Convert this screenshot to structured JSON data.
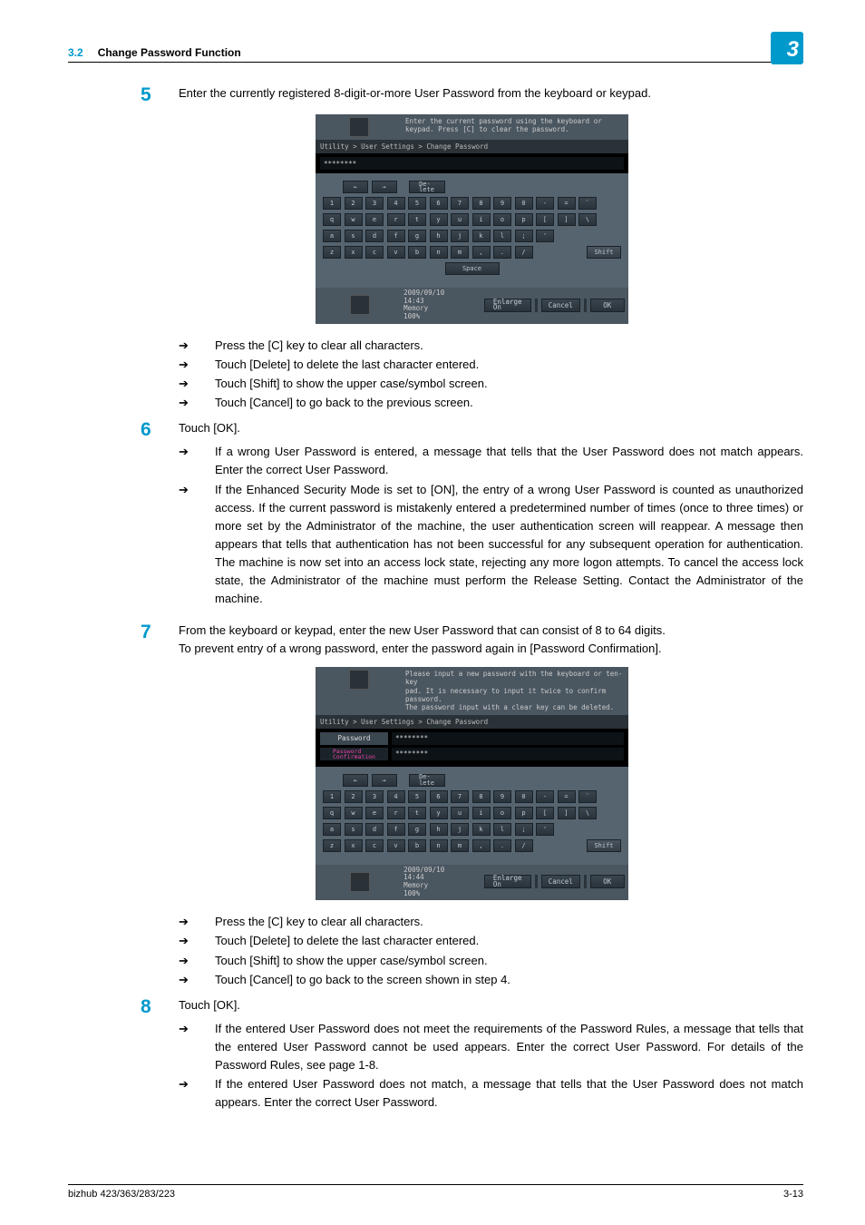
{
  "header": {
    "section_num": "3.2",
    "section_title": "Change Password Function",
    "chapter": "3"
  },
  "step5": {
    "num": "5",
    "text": "Enter the currently registered 8-digit-or-more User Password from the keyboard or keypad.",
    "bullets": [
      "Press the [C] key to clear all characters.",
      "Touch [Delete] to delete the last character entered.",
      "Touch [Shift] to show the upper case/symbol screen.",
      "Touch [Cancel] to go back to the previous screen."
    ]
  },
  "step6": {
    "num": "6",
    "text": "Touch [OK].",
    "bullets": [
      "If a wrong User Password is entered, a message that tells that the User Password does not match appears. Enter the correct User Password.",
      "If the Enhanced Security Mode is set to [ON], the entry of a wrong User Password is counted as unauthorized access. If the current password is mistakenly entered a predetermined number of times (once to three times) or more set by the Administrator of the machine, the user authentication screen will reappear. A message then appears that tells that authentication has not been successful for any subsequent operation for authentication. The machine is now set into an access lock state, rejecting any more logon attempts. To cancel the access lock state, the Administrator of the machine must perform the Release Setting. Contact the Administrator of the machine."
    ]
  },
  "step7": {
    "num": "7",
    "text1": "From the keyboard or keypad, enter the new User Password that can consist of 8 to 64 digits.",
    "text2": "To prevent entry of a wrong password, enter the password again in [Password Confirmation].",
    "bullets": [
      "Press the [C] key to clear all characters.",
      "Touch [Delete] to delete the last character entered.",
      "Touch [Shift] to show the upper case/symbol screen.",
      "Touch [Cancel] to go back to the screen shown in step 4."
    ]
  },
  "step8": {
    "num": "8",
    "text": "Touch [OK].",
    "bullets": [
      "If the entered User Password does not meet the requirements of the Password Rules, a message that tells that the entered User Password cannot be used appears. Enter the correct User Password. For details of the Password Rules, see page 1-8.",
      "If the entered User Password does not match, a message that tells that the User Password does not match appears. Enter the correct User Password."
    ]
  },
  "screen1": {
    "instr": "Enter the current password using the keyboard or\nkeypad.  Press [C] to clear the password.",
    "breadcrumb": "Utility > User Settings > Change Password",
    "value": "********",
    "delete": "De-\nlete",
    "row1": [
      "1",
      "2",
      "3",
      "4",
      "5",
      "6",
      "7",
      "8",
      "9",
      "0",
      "-",
      "=",
      "`"
    ],
    "row2": [
      "q",
      "w",
      "e",
      "r",
      "t",
      "y",
      "u",
      "i",
      "o",
      "p",
      "[",
      "]",
      "\\"
    ],
    "row3": [
      "a",
      "s",
      "d",
      "f",
      "g",
      "h",
      "j",
      "k",
      "l",
      ";",
      "'"
    ],
    "row4": [
      "z",
      "x",
      "c",
      "v",
      "b",
      "n",
      "m",
      ",",
      ".",
      "/"
    ],
    "shift": "Shift",
    "space": "Space",
    "date": "2009/09/10",
    "time": "14:43",
    "memory": "Memory",
    "mempct": "100%",
    "enlarge": "Enlarge\nOn",
    "cancel": "Cancel",
    "ok": "OK"
  },
  "screen2": {
    "instr": "Please input a new password with the keyboard or ten-key\npad.  It is necessary to input it twice to confirm password.\nThe password input with a clear key can be deleted.",
    "breadcrumb": "Utility > User Settings > Change Password",
    "tab1": "Password",
    "tab2": "Password\nConfirmation",
    "value1": "********",
    "value2": "********",
    "delete": "De-\nlete",
    "row1": [
      "1",
      "2",
      "3",
      "4",
      "5",
      "6",
      "7",
      "8",
      "9",
      "0",
      "-",
      "=",
      "`"
    ],
    "row2": [
      "q",
      "w",
      "e",
      "r",
      "t",
      "y",
      "u",
      "i",
      "o",
      "p",
      "[",
      "]",
      "\\"
    ],
    "row3": [
      "a",
      "s",
      "d",
      "f",
      "g",
      "h",
      "j",
      "k",
      "l",
      ";",
      "'"
    ],
    "row4": [
      "z",
      "x",
      "c",
      "v",
      "b",
      "n",
      "m",
      ",",
      ".",
      "/"
    ],
    "shift": "Shift",
    "date": "2009/09/10",
    "time": "14:44",
    "memory": "Memory",
    "mempct": "100%",
    "enlarge": "Enlarge\nOn",
    "cancel": "Cancel",
    "ok": "OK"
  },
  "footer": {
    "model": "bizhub 423/363/283/223",
    "page": "3-13"
  }
}
